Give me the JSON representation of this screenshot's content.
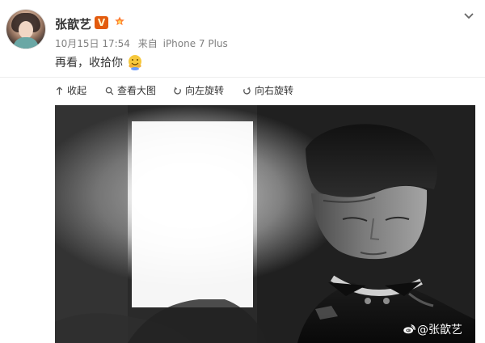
{
  "post": {
    "username": "张歆艺",
    "verified_badge": "V",
    "fan_badge_icon": "fan-badge-icon",
    "date": "10月15日 17:54",
    "source_label": "来自",
    "source": "iPhone 7 Plus",
    "text": "再看，收拾你",
    "emoji_icon": "hugging-face-emoji-icon",
    "menu_icon": "chevron-down-icon"
  },
  "toolbar": {
    "collapse_label": "收起",
    "view_large_label": "查看大图",
    "rotate_left_label": "向左旋转",
    "rotate_right_label": "向右旋转"
  },
  "image": {
    "watermark_text": "@张歆艺",
    "description_icon": "weibo-logo-icon"
  },
  "colors": {
    "verified_badge": "#e35b0e",
    "meta_text": "#808080",
    "main_text": "#333333",
    "divider": "#eeeeee"
  }
}
